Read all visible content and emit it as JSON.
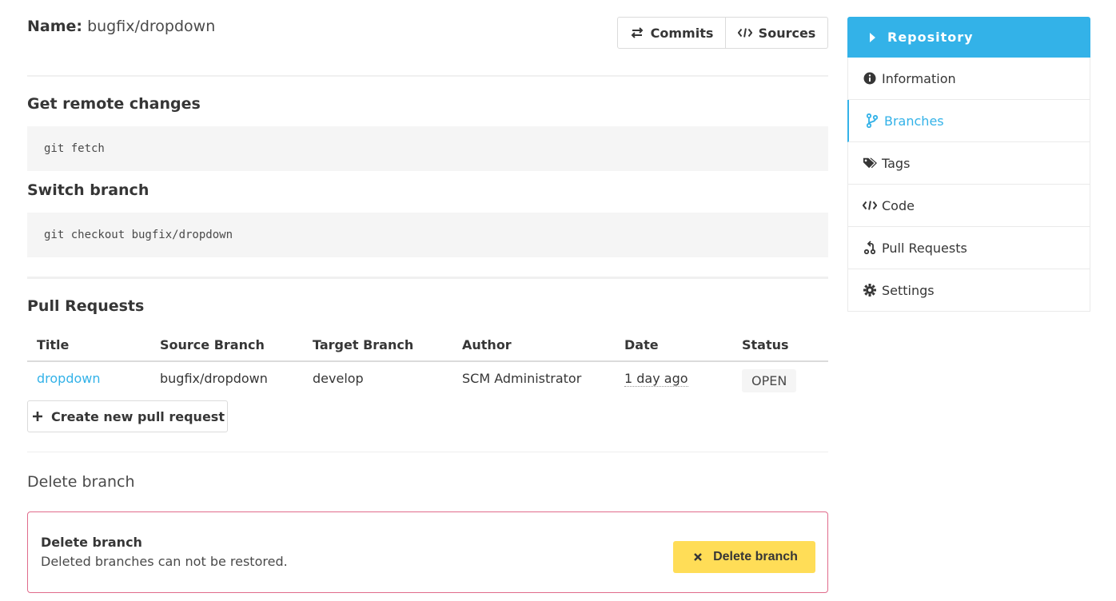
{
  "branch": {
    "name_label": "Name:",
    "name_value": "bugfix/dropdown"
  },
  "toolbar": {
    "commits_label": "Commits",
    "sources_label": "Sources"
  },
  "sections": {
    "remote_title": "Get remote changes",
    "remote_cmd": "git fetch",
    "switch_title": "Switch branch",
    "switch_cmd": "git checkout bugfix/dropdown",
    "pr_title": "Pull Requests"
  },
  "pull_requests": {
    "headers": [
      "Title",
      "Source Branch",
      "Target Branch",
      "Author",
      "Date",
      "Status"
    ],
    "rows": [
      {
        "title": "dropdown",
        "source": "bugfix/dropdown",
        "target": "develop",
        "author": "SCM Administrator",
        "date": "1 day ago",
        "status": "OPEN"
      }
    ],
    "create_label": "Create new pull request"
  },
  "delete": {
    "section_title": "Delete branch",
    "box_title": "Delete branch",
    "box_text": "Deleted branches can not be restored.",
    "button_label": "Delete branch"
  },
  "sidebar": {
    "header": "Repository",
    "items": [
      {
        "label": "Information",
        "icon": "info-circle-icon"
      },
      {
        "label": "Branches",
        "icon": "code-branch-icon",
        "active": true
      },
      {
        "label": "Tags",
        "icon": "tags-icon"
      },
      {
        "label": "Code",
        "icon": "code-icon"
      },
      {
        "label": "Pull Requests",
        "icon": "pull-request-icon"
      },
      {
        "label": "Settings",
        "icon": "cog-icon"
      }
    ]
  },
  "colors": {
    "accent": "#33b2e8",
    "danger_border": "#e06b8b",
    "warning": "#ffdd57",
    "code_bg": "#f5f5f5"
  }
}
